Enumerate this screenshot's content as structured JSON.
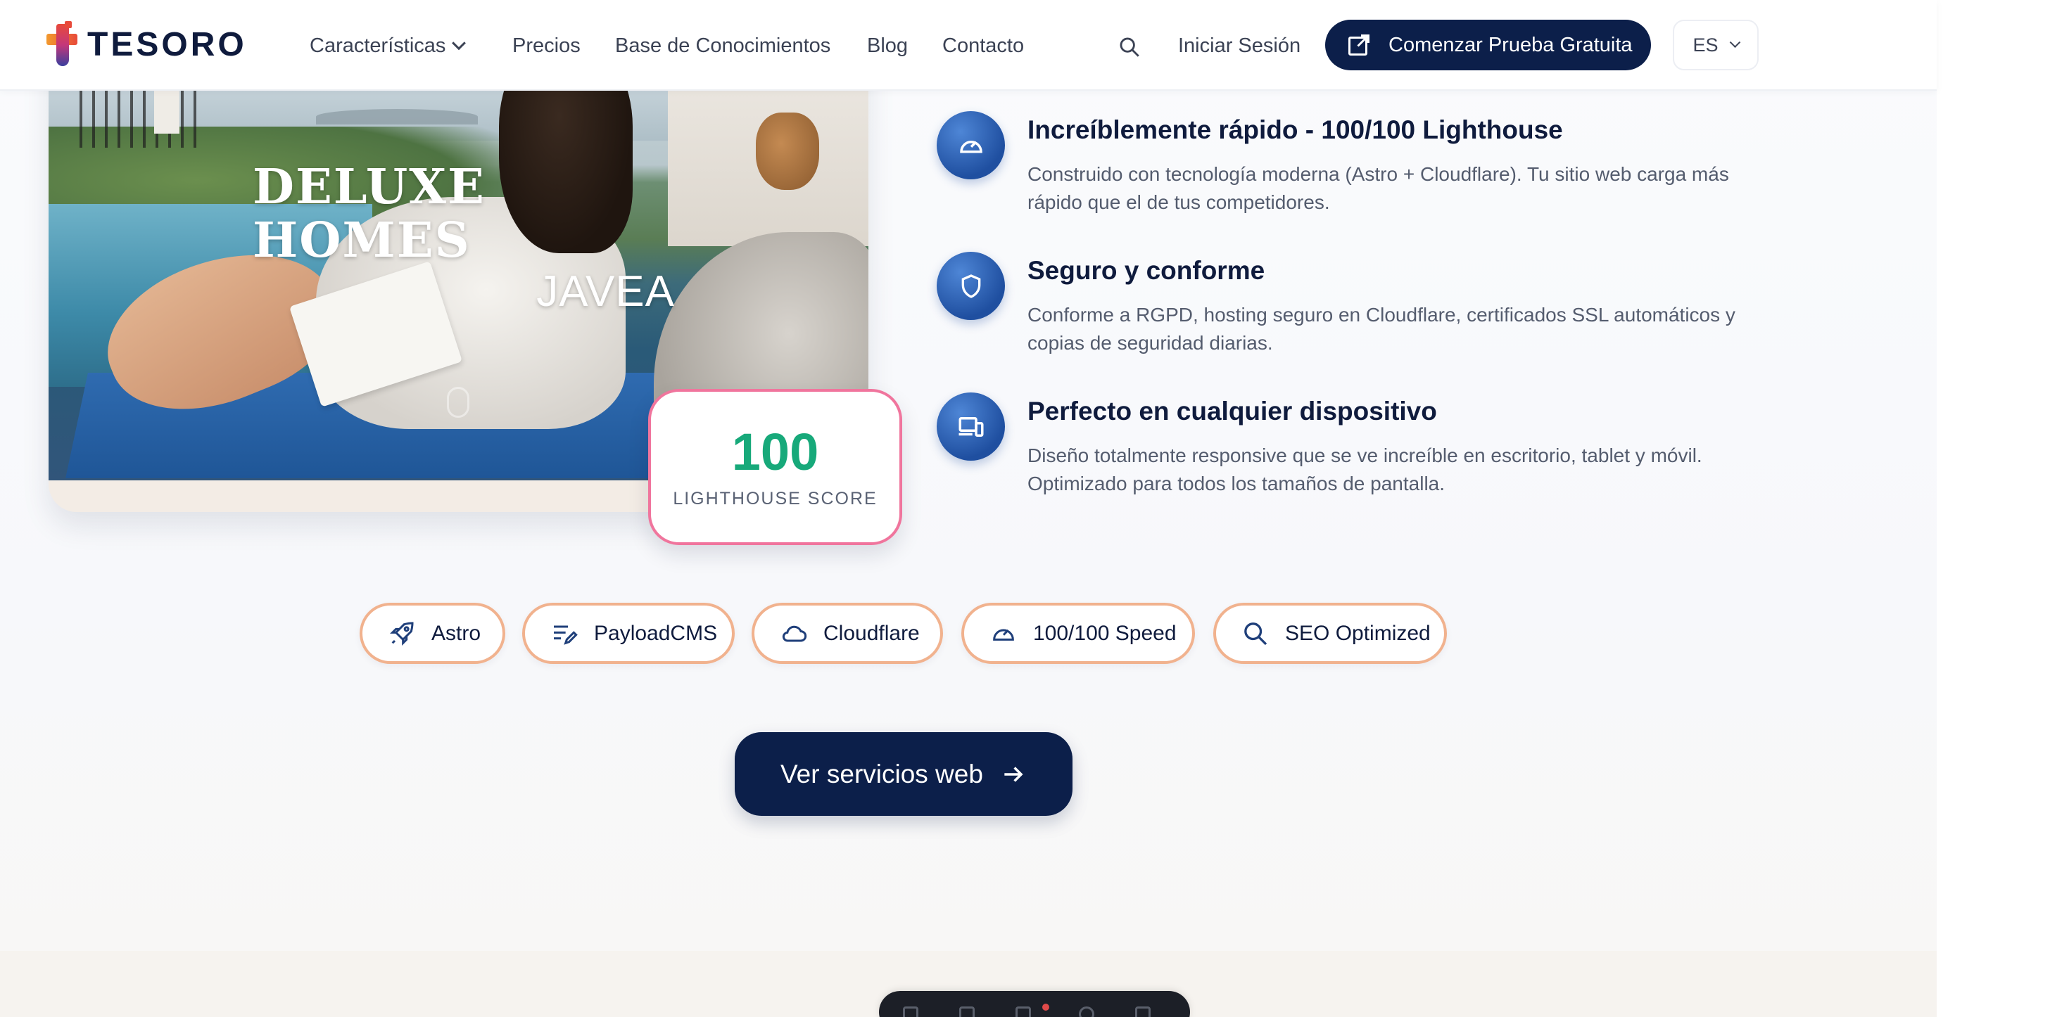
{
  "header": {
    "logo_text": "TESORO",
    "nav": [
      {
        "label": "Características",
        "has_dropdown": true
      },
      {
        "label": "Precios"
      },
      {
        "label": "Base de Conocimientos"
      },
      {
        "label": "Blog"
      },
      {
        "label": "Contacto"
      }
    ],
    "login_label": "Iniciar Sesión",
    "cta_label": "Comenzar Prueba Gratuita",
    "language": "ES"
  },
  "showcase": {
    "brand_line1": "DELUXE HOMES",
    "brand_line2": "JAVEA",
    "score_value": "100",
    "score_label": "LIGHTHOUSE SCORE"
  },
  "features": [
    {
      "icon": "speedometer-icon",
      "title": "Increíblemente rápido - 100/100 Lighthouse",
      "description": "Construido con tecnología moderna (Astro + Cloudflare). Tu sitio web carga más rápido que el de tus competidores."
    },
    {
      "icon": "shield-icon",
      "title": "Seguro y conforme",
      "description": "Conforme a RGPD, hosting seguro en Cloudflare, certificados SSL automáticos y copias de seguridad diarias."
    },
    {
      "icon": "devices-icon",
      "title": "Perfecto en cualquier dispositivo",
      "description": "Diseño totalmente responsive que se ve increíble en escritorio, tablet y móvil. Optimizado para todos los tamaños de pantalla."
    }
  ],
  "tech_pills": [
    {
      "label": "Astro",
      "icon": "rocket-icon"
    },
    {
      "label": "PayloadCMS",
      "icon": "edit-list-icon"
    },
    {
      "label": "Cloudflare",
      "icon": "cloud-icon"
    },
    {
      "label": "100/100 Speed",
      "icon": "speedometer-icon"
    },
    {
      "label": "SEO Optimized",
      "icon": "search-icon"
    }
  ],
  "cta_main_label": "Ver servicios web",
  "colors": {
    "navy": "#0c1f4a",
    "score_green": "#17a97a",
    "score_border": "#f0759d",
    "pill_border": "#f1b28e",
    "feature_icon": "#1f4fa0"
  }
}
